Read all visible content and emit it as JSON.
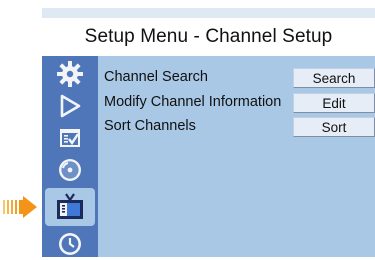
{
  "title": "Setup Menu - Channel Setup",
  "sidebar": {
    "items": [
      {
        "icon": "gear-icon"
      },
      {
        "icon": "play-icon"
      },
      {
        "icon": "checklist-icon"
      },
      {
        "icon": "disc-icon"
      },
      {
        "icon": "tv-icon",
        "active": true
      },
      {
        "icon": "clock-icon"
      }
    ]
  },
  "rows": [
    {
      "label": "Channel Search",
      "button": "Search"
    },
    {
      "label": "Modify Channel Information",
      "button": "Edit"
    },
    {
      "label": "Sort Channels",
      "button": "Sort"
    }
  ],
  "colors": {
    "panel": "#a9c8e6",
    "sidebar": "#4e76b8",
    "pointer": "#f5a623"
  }
}
